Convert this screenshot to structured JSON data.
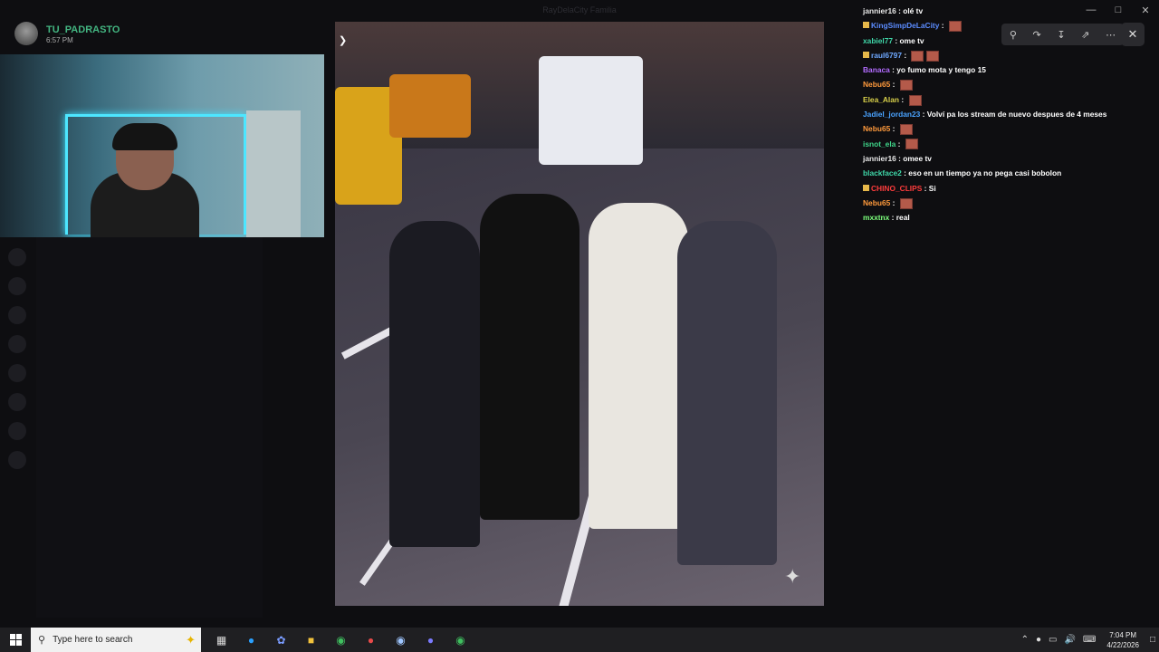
{
  "window": {
    "title": "RayDelaCity Familia"
  },
  "streamer": {
    "name": "TU_PADRASTO",
    "time": "6:57 PM"
  },
  "chat": [
    {
      "user": "jannier16",
      "color": "#e8e8e8",
      "msg": "olé tv",
      "badge": false,
      "emotes": 0
    },
    {
      "user": "KingSimpDeLaCity",
      "color": "#5b8cff",
      "msg": "",
      "badge": true,
      "emotes": 1
    },
    {
      "user": "xabiel77",
      "color": "#3fd6a8",
      "msg": "ome tv",
      "badge": false,
      "emotes": 0
    },
    {
      "user": "raul6797",
      "color": "#6ea8ff",
      "msg": "",
      "badge": true,
      "emotes": 2
    },
    {
      "user": "Banaca",
      "color": "#b36cff",
      "msg": "yo fumo mota y tengo 15",
      "badge": false,
      "emotes": 0
    },
    {
      "user": "Nebu65",
      "color": "#ff9a3c",
      "msg": "",
      "badge": false,
      "emotes": 1
    },
    {
      "user": "Elea_Alan",
      "color": "#d8d04a",
      "msg": "",
      "badge": false,
      "emotes": 1
    },
    {
      "user": "Jadiel_jordan23",
      "color": "#4aa3ff",
      "msg": "Volví pa los stream de nuevo despues de 4 meses",
      "badge": false,
      "emotes": 0
    },
    {
      "user": "Nebu65",
      "color": "#ff9a3c",
      "msg": "",
      "badge": false,
      "emotes": 1
    },
    {
      "user": "isnot_ela",
      "color": "#3fd68a",
      "msg": "",
      "badge": false,
      "emotes": 1
    },
    {
      "user": "jannier16",
      "color": "#e8e8e8",
      "msg": "omee tv",
      "badge": false,
      "emotes": 0
    },
    {
      "user": "blackface2",
      "color": "#3fd6a8",
      "msg": "eso en un tiempo ya no pega casi bobolon",
      "badge": false,
      "emotes": 0
    },
    {
      "user": "CHINO_CLIPS",
      "color": "#ff3c3c",
      "msg": "Si",
      "badge": true,
      "emotes": 0
    },
    {
      "user": "Nebu65",
      "color": "#ff9a3c",
      "msg": "",
      "badge": false,
      "emotes": 1
    },
    {
      "user": "mxxtnx",
      "color": "#7cff7c",
      "msg": "real",
      "badge": false,
      "emotes": 0
    }
  ],
  "taskbar": {
    "search_placeholder": "Type here to search",
    "time": "7:04 PM",
    "date": "4/22/2026"
  },
  "icons": {
    "zoom": "search-icon",
    "rotate": "rotate-icon",
    "download": "download-icon",
    "open-external": "external-link-icon",
    "more": "more-icon",
    "close": "close-icon"
  }
}
